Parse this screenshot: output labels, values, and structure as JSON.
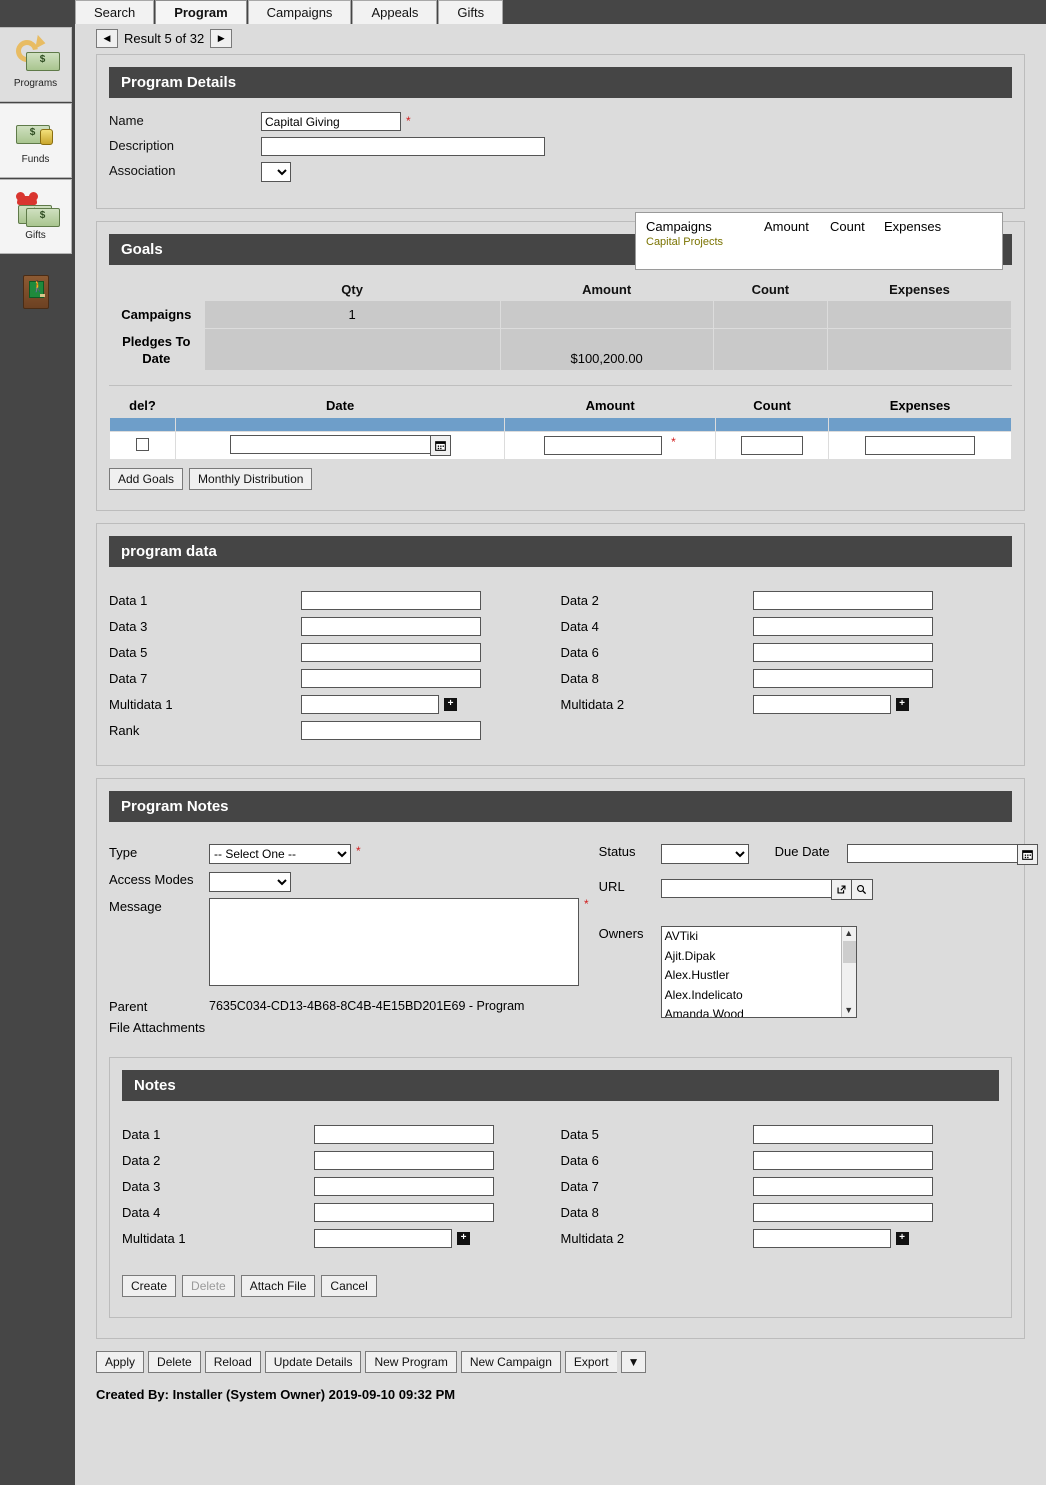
{
  "tabs": [
    {
      "label": "Search",
      "active": false
    },
    {
      "label": "Program",
      "active": true
    },
    {
      "label": "Campaigns",
      "active": false
    },
    {
      "label": "Appeals",
      "active": false
    },
    {
      "label": "Gifts",
      "active": false
    }
  ],
  "sidebar": {
    "items": [
      {
        "label": "Programs",
        "icon": "programs-icon",
        "active": true
      },
      {
        "label": "Funds",
        "icon": "funds-icon",
        "active": false
      },
      {
        "label": "Gifts",
        "icon": "gifts-icon",
        "active": false
      }
    ],
    "exit": {
      "icon": "exit-door-icon"
    }
  },
  "result_nav": {
    "prev_icon": "◀",
    "next_icon": "▶",
    "text": "Result 5 of 32"
  },
  "program_details": {
    "title": "Program Details",
    "name_label": "Name",
    "name_value": "Capital Giving",
    "description_label": "Description",
    "description_value": "",
    "association_label": "Association",
    "association_value": "",
    "required_marker": "*",
    "campaigns_box": {
      "col_campaigns": "Campaigns",
      "col_amount": "Amount",
      "col_count": "Count",
      "col_expenses": "Expenses",
      "rows": [
        "Capital Projects"
      ]
    }
  },
  "goals": {
    "title": "Goals",
    "summary": {
      "columns": [
        "Qty",
        "Amount",
        "Count",
        "Expenses"
      ],
      "rows": [
        {
          "label": "Campaigns",
          "qty": "1",
          "amount": "",
          "count": "",
          "expenses": ""
        },
        {
          "label": "Pledges To Date",
          "qty": "",
          "amount": "$100,200.00",
          "count": "",
          "expenses": ""
        }
      ]
    },
    "grid": {
      "columns": [
        "del?",
        "Date",
        "Amount",
        "Count",
        "Expenses"
      ],
      "row": {
        "del_checked": false,
        "date": "",
        "amount": "",
        "count": "",
        "expenses": ""
      },
      "amount_required": "*",
      "calendar_icon": "calendar-icon"
    },
    "buttons": {
      "add_goals": "Add Goals",
      "monthly_distribution": "Monthly Distribution"
    }
  },
  "program_data": {
    "title": "program data",
    "left": [
      {
        "label": "Data 1",
        "value": ""
      },
      {
        "label": "Data 3",
        "value": ""
      },
      {
        "label": "Data 5",
        "value": ""
      },
      {
        "label": "Data 7",
        "value": ""
      },
      {
        "label": "Multidata 1",
        "value": "",
        "multi": true
      },
      {
        "label": "Rank",
        "value": ""
      }
    ],
    "right": [
      {
        "label": "Data 2",
        "value": ""
      },
      {
        "label": "Data 4",
        "value": ""
      },
      {
        "label": "Data 6",
        "value": ""
      },
      {
        "label": "Data 8",
        "value": ""
      },
      {
        "label": "Multidata 2",
        "value": "",
        "multi": true
      }
    ],
    "plus_icon": "plus-icon"
  },
  "program_notes": {
    "title": "Program Notes",
    "type_label": "Type",
    "type_value": "-- Select One --",
    "type_required": "*",
    "access_modes_label": "Access Modes",
    "access_modes_value": "",
    "message_label": "Message",
    "message_value": "",
    "message_required": "*",
    "status_label": "Status",
    "status_value": "",
    "due_date_label": "Due Date",
    "due_date_value": "",
    "due_date_icon": "calendar-icon",
    "url_label": "URL",
    "url_value": "",
    "url_open_icon": "external-link-icon",
    "url_search_icon": "search-icon",
    "owners_label": "Owners",
    "owners": [
      "AVTiki",
      "Ajit.Dipak",
      "Alex.Hustler",
      "Alex.Indelicato",
      "Amanda.Wood"
    ],
    "parent_label": "Parent",
    "parent_value": "7635C034-CD13-4B68-8C4B-4E15BD201E69 - Program",
    "file_attachments_label": "File Attachments"
  },
  "notes": {
    "title": "Notes",
    "left": [
      {
        "label": "Data 1",
        "value": ""
      },
      {
        "label": "Data 2",
        "value": ""
      },
      {
        "label": "Data 3",
        "value": ""
      },
      {
        "label": "Data 4",
        "value": ""
      },
      {
        "label": "Multidata 1",
        "value": "",
        "multi": true
      }
    ],
    "right": [
      {
        "label": "Data 5",
        "value": ""
      },
      {
        "label": "Data 6",
        "value": ""
      },
      {
        "label": "Data 7",
        "value": ""
      },
      {
        "label": "Data 8",
        "value": ""
      },
      {
        "label": "Multidata 2",
        "value": "",
        "multi": true
      }
    ],
    "buttons": [
      {
        "label": "Create",
        "disabled": false
      },
      {
        "label": "Delete",
        "disabled": true
      },
      {
        "label": "Attach File",
        "disabled": false
      },
      {
        "label": "Cancel",
        "disabled": false
      }
    ]
  },
  "footer": {
    "buttons": [
      {
        "label": "Apply"
      },
      {
        "label": "Delete"
      },
      {
        "label": "Reload"
      },
      {
        "label": "Update Details"
      },
      {
        "label": "New Program"
      },
      {
        "label": "New Campaign"
      },
      {
        "label": "Export"
      }
    ],
    "dropdown_icon": "▼",
    "created_by": "Created By: Installer (System Owner) 2019-09-10 09:32 PM"
  },
  "colors": {
    "panel_header": "#454545",
    "grid_header_blue": "#6e9ec9",
    "required": "#d01d1d",
    "campaign_link": "#7a7300",
    "page_bg": "#dcdcdc"
  }
}
